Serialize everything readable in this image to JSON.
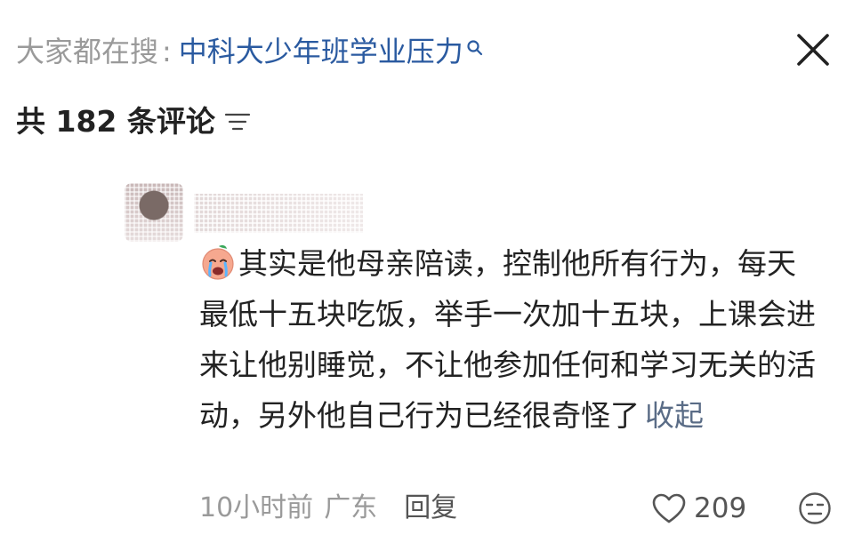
{
  "search": {
    "prefix": "大家都在搜",
    "separator": ":",
    "term": "中科大少年班学业压力",
    "term_icon": "search-icon"
  },
  "close_icon": "close-icon",
  "comments_header": {
    "label": "共 182 条评论",
    "sort_icon": "sort-icon"
  },
  "comment": {
    "emoji": "crying-face-emoji",
    "text": "其实是他母亲陪读，控制他所有行为，每天最低十五块吃饭，举手一次加十五块，上课会进来让他别睡觉，不让他参加任何和学习无关的活动，另外他自己行为已经很奇怪了",
    "collapse_label": "收起",
    "time": "10小时前",
    "location": "广东",
    "reply_label": "回复",
    "likes": "209",
    "like_icon": "heart-icon",
    "dislike_icon": "dislike-face-icon"
  },
  "colors": {
    "search_term": "#2a5aa0",
    "muted": "#9a9a9a",
    "collapse_link": "#5a6c86",
    "text": "#222222"
  }
}
